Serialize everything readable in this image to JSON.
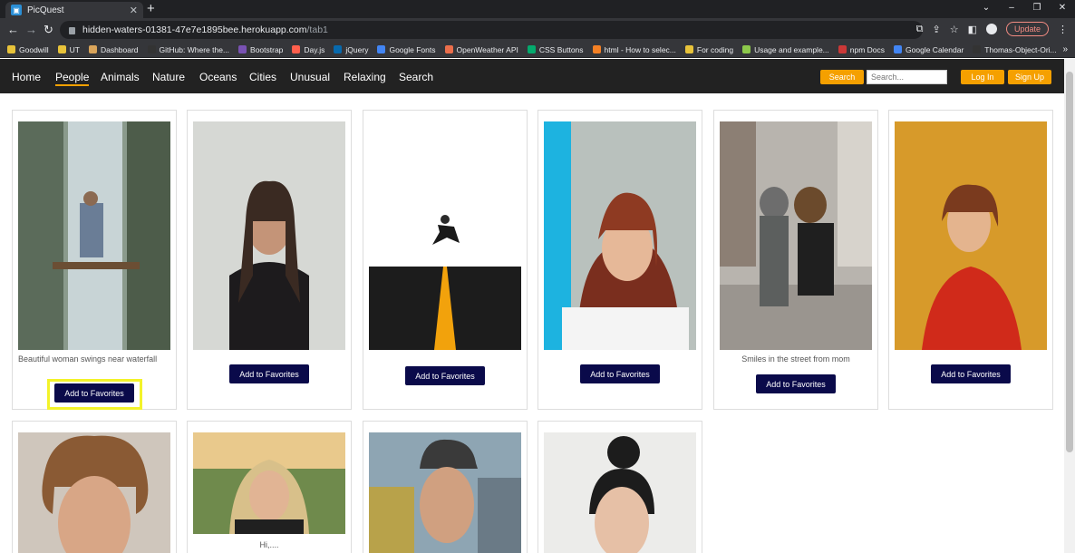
{
  "browser": {
    "tab_title": "PicQuest",
    "url_host": "hidden-waters-01381-47e7e1895bee.herokuapp.com",
    "url_path": "/tab1",
    "update_label": "Update",
    "bookmarks": [
      {
        "label": "Goodwill",
        "color": "#e8c33a"
      },
      {
        "label": "UT",
        "color": "#e8c33a"
      },
      {
        "label": "Dashboard",
        "color": "#d9a45a"
      },
      {
        "label": "GitHub: Where the...",
        "color": "#333333"
      },
      {
        "label": "Bootstrap",
        "color": "#7952b3"
      },
      {
        "label": "Day.js",
        "color": "#ff5f4c"
      },
      {
        "label": "jQuery",
        "color": "#0769ad"
      },
      {
        "label": "Google Fonts",
        "color": "#4285f4"
      },
      {
        "label": "OpenWeather API",
        "color": "#eb6e4b"
      },
      {
        "label": "CSS Buttons",
        "color": "#04aa6d"
      },
      {
        "label": "html - How to selec...",
        "color": "#f48024"
      },
      {
        "label": "For coding",
        "color": "#e8c33a"
      },
      {
        "label": "Usage and example...",
        "color": "#8cc84b"
      },
      {
        "label": "npm Docs",
        "color": "#cb3837"
      },
      {
        "label": "Google Calendar",
        "color": "#4285f4"
      },
      {
        "label": "Thomas-Object-Ori...",
        "color": "#333333"
      }
    ]
  },
  "nav": {
    "links": [
      "Home",
      "People",
      "Animals",
      "Nature",
      "Oceans",
      "Cities",
      "Unusual",
      "Relaxing",
      "Search"
    ],
    "active": "People",
    "search_button": "Search",
    "search_placeholder": "Search...",
    "login": "Log In",
    "signup": "Sign Up",
    "accent_color": "#f5a000"
  },
  "cards": [
    {
      "caption": "Beautiful woman swings near waterfall",
      "button": "Add to Favorites"
    },
    {
      "caption": "",
      "button": "Add to Favorites"
    },
    {
      "caption": "",
      "button": "Add to Favorites"
    },
    {
      "caption": "",
      "button": "Add to Favorites"
    },
    {
      "caption": "Smiles in the street from mom",
      "button": "Add to Favorites"
    },
    {
      "caption": "",
      "button": "Add to Favorites"
    },
    {
      "caption": "",
      "button": ""
    },
    {
      "caption": "Hi,....",
      "button": ""
    },
    {
      "caption": "",
      "button": ""
    },
    {
      "caption": "",
      "button": ""
    }
  ]
}
